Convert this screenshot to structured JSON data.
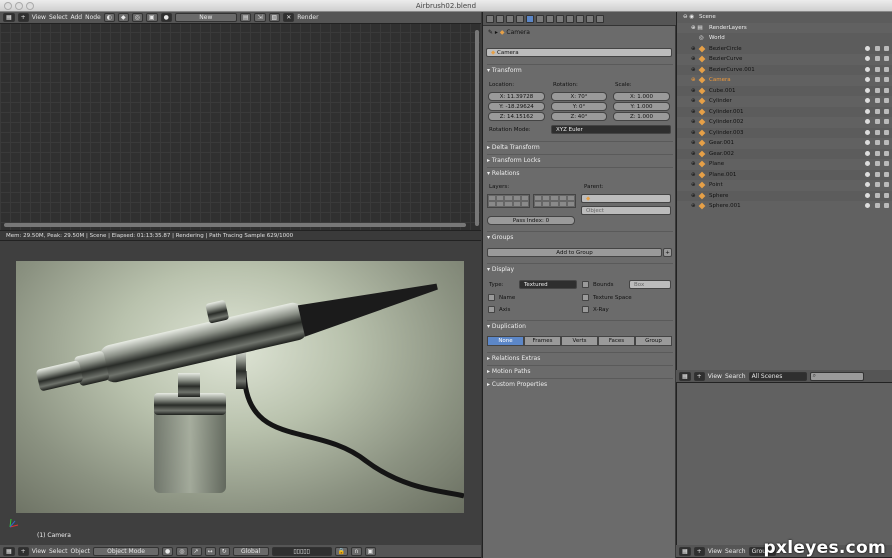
{
  "window": {
    "title": "Airbrush02.blend"
  },
  "node_header": {
    "menus": [
      "View",
      "Select",
      "Add",
      "Node"
    ],
    "new_label": "New",
    "render_label": "Render"
  },
  "status_bar": {
    "text": "Mem: 29.50M, Peak: 29.50M | Scene | Elapsed: 01:13:35.87 | Rendering | Path Tracing Sample 629/1000"
  },
  "viewport": {
    "camera_label": "(1) Camera",
    "header_menus": [
      "View",
      "Select",
      "Object"
    ],
    "mode": "Object Mode",
    "pivot": "Global"
  },
  "properties": {
    "breadcrumb": "Camera",
    "object_name": "Camera",
    "transform": {
      "title": "Transform",
      "location_label": "Location:",
      "rotation_label": "Rotation:",
      "scale_label": "Scale:",
      "location": [
        "X: 11.39728",
        "Y: -18.29624",
        "Z: 14.15162"
      ],
      "rotation": [
        "X: 70°",
        "Y: 0°",
        "Z: 40°"
      ],
      "scale": [
        "X: 1.000",
        "Y: 1.000",
        "Z: 1.000"
      ],
      "rotation_mode_label": "Rotation Mode:",
      "rotation_mode": "XYZ Euler"
    },
    "collapsed_sections": [
      "Delta Transform",
      "Transform Locks"
    ],
    "relations": {
      "title": "Relations",
      "layers_label": "Layers:",
      "parent_label": "Parent:",
      "parent_type": "Object",
      "pass_index": "Pass Index: 0"
    },
    "groups": {
      "title": "Groups",
      "add_label": "Add to Group"
    },
    "display": {
      "title": "Display",
      "type_label": "Type:",
      "type_value": "Textured",
      "bounds_label": "Bounds",
      "bounds_value": "Box",
      "name_label": "Name",
      "texture_space_label": "Texture Space",
      "axis_label": "Axis",
      "xray_label": "X-Ray"
    },
    "duplication": {
      "title": "Duplication",
      "options": [
        "None",
        "Frames",
        "Verts",
        "Faces",
        "Group"
      ],
      "selected": "None"
    },
    "more_sections": [
      "Relations Extras",
      "Motion Paths",
      "Custom Properties"
    ]
  },
  "outliner": {
    "scene": "Scene",
    "render_layers": "RenderLayers",
    "world": "World",
    "objects": [
      "BezierCircle",
      "BezierCurve",
      "BezierCurve.001",
      "Camera",
      "Cube.001",
      "Cylinder",
      "Cylinder.001",
      "Cylinder.002",
      "Cylinder.003",
      "Gear.001",
      "Gear.002",
      "Plane",
      "Plane.001",
      "Point",
      "Sphere",
      "Sphere.001"
    ],
    "selected": "Camera",
    "header_menus": [
      "View",
      "Search"
    ],
    "display_mode": "All Scenes"
  },
  "lower_panel": {
    "header_menus": [
      "View",
      "Search"
    ],
    "mode": "Groups"
  },
  "watermark": {
    "text": "pxleyes.com"
  },
  "colors": {
    "accent_blue": "#5c87c8",
    "selected_orange": "#f09a3a",
    "panel_gray": "#6b6b6b"
  }
}
